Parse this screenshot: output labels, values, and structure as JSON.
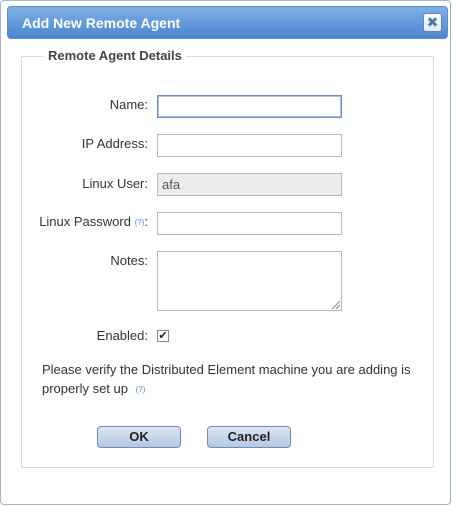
{
  "dialog": {
    "title": "Add New Remote Agent",
    "close_icon": "close-icon",
    "close_glyph": "✖"
  },
  "fieldset": {
    "legend": "Remote Agent Details"
  },
  "form": {
    "name_label": "Name:",
    "ip_label": "IP Address:",
    "linux_user_label": "Linux User:",
    "linux_user_value": "afa",
    "linux_password_label": "Linux Password",
    "help_glyph": "(?)",
    "colon": ":",
    "notes_label": "Notes:",
    "enabled_label": "Enabled:",
    "enabled_checked": true,
    "check_glyph": "✔"
  },
  "note": {
    "text": "Please verify the Distributed Element machine you are adding is properly set up",
    "help_glyph": "(?)"
  },
  "buttons": {
    "ok_label": "OK",
    "cancel_label": "Cancel"
  },
  "colors": {
    "titlebar": "#4a86cf",
    "title_text": "#ffffff",
    "help_link": "#5b8ed4",
    "button_fill": "#b4c9e2"
  }
}
